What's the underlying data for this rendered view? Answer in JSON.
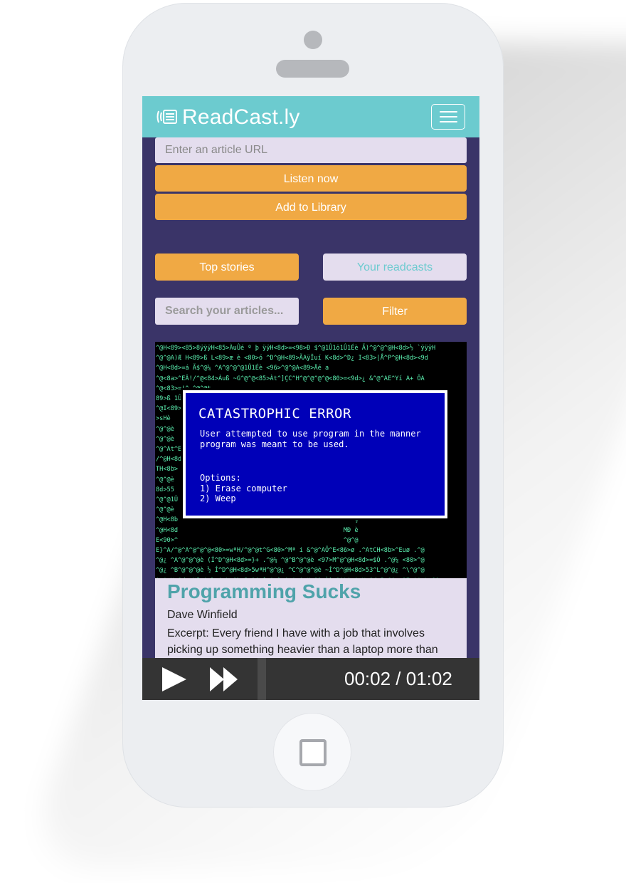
{
  "app": {
    "brand_name": "ReadCast.ly",
    "brand_icon": "readcast-logo-icon",
    "menu_icon": "hamburger-menu-icon",
    "colors": {
      "navbar": "#6ccbcf",
      "background": "#3a3468",
      "accent_button": "#f0a944",
      "input_bg": "#e4ddee",
      "title_text": "#4fa3aa",
      "player_bg": "#343434"
    }
  },
  "add_article": {
    "url_placeholder": "Enter an article URL",
    "listen_label": "Listen now",
    "add_label": "Add to Library"
  },
  "tabs": [
    {
      "label": "Top stories",
      "active": true
    },
    {
      "label": "Your readcasts",
      "active": false
    }
  ],
  "search": {
    "placeholder": "Search your articles...",
    "filter_label": "Filter"
  },
  "article": {
    "image": {
      "error_title": "CATASTROPHIC ERROR",
      "error_message": "User attempted to use program in the manner program was meant to be used.",
      "options_label": "Options:",
      "option_1": "1) Erase computer",
      "option_2": "2) Weep"
    },
    "title": "Programming Sucks",
    "author": "Dave Winfield",
    "excerpt": "Excerpt: Every friend I have with a job that involves picking up something heavier than a laptop more than"
  },
  "player": {
    "play_icon": "play-icon",
    "forward_icon": "fast-forward-icon",
    "elapsed": "00:02",
    "separator": " / ",
    "duration": "01:02",
    "progress_fraction": 0.03
  }
}
